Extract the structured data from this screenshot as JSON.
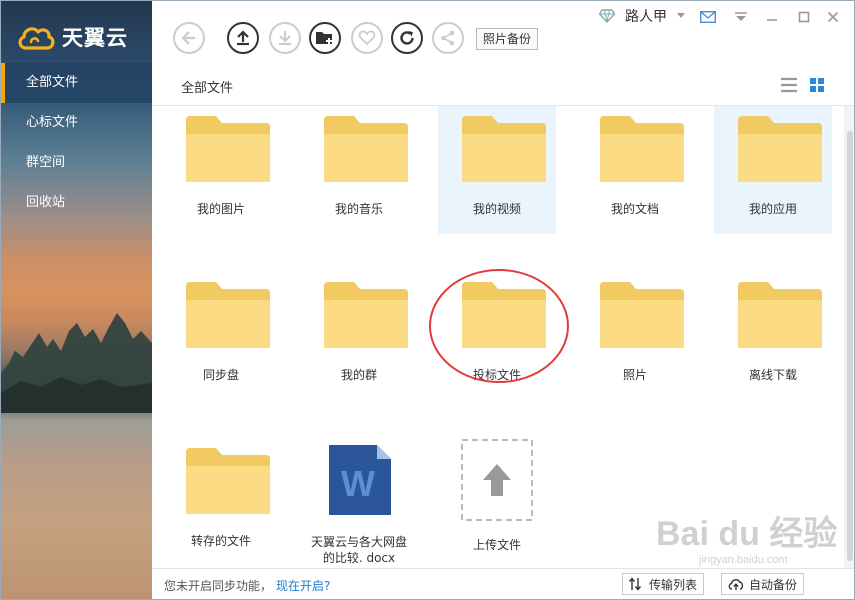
{
  "app": {
    "title": "天翼云"
  },
  "user": {
    "name": "路人甲"
  },
  "toolbar": {
    "photo_backup_label": "照片备份"
  },
  "sidebar": {
    "items": [
      {
        "label": "全部文件"
      },
      {
        "label": "心标文件"
      },
      {
        "label": "群空间"
      },
      {
        "label": "回收站"
      }
    ]
  },
  "breadcrumb": {
    "current": "全部文件"
  },
  "files": [
    {
      "name": "我的图片"
    },
    {
      "name": "我的音乐"
    },
    {
      "name": "我的视频"
    },
    {
      "name": "我的文档"
    },
    {
      "name": "我的应用"
    },
    {
      "name": "同步盘"
    },
    {
      "name": "我的群"
    },
    {
      "name": "投标文件"
    },
    {
      "name": "照片"
    },
    {
      "name": "离线下载"
    },
    {
      "name": "转存的文件"
    },
    {
      "name_line1": "天翼云与各大网盘",
      "name_line2": "的比较. docx",
      "badge": "W"
    },
    {
      "name": "上传文件"
    }
  ],
  "status": {
    "sync_text": "您未开启同步功能，",
    "sync_link": "现在开启?",
    "transfer_label": "传输列表",
    "auto_backup_label": "自动备份"
  },
  "watermark": {
    "text": "Bai du 经验",
    "sub": "jingyan.baidu.com"
  },
  "colors": {
    "accent": "#f2a900",
    "link": "#1f7acb",
    "selection": "#eaf4fd",
    "annotation": "#e33a3a",
    "word": "#2b579a"
  }
}
